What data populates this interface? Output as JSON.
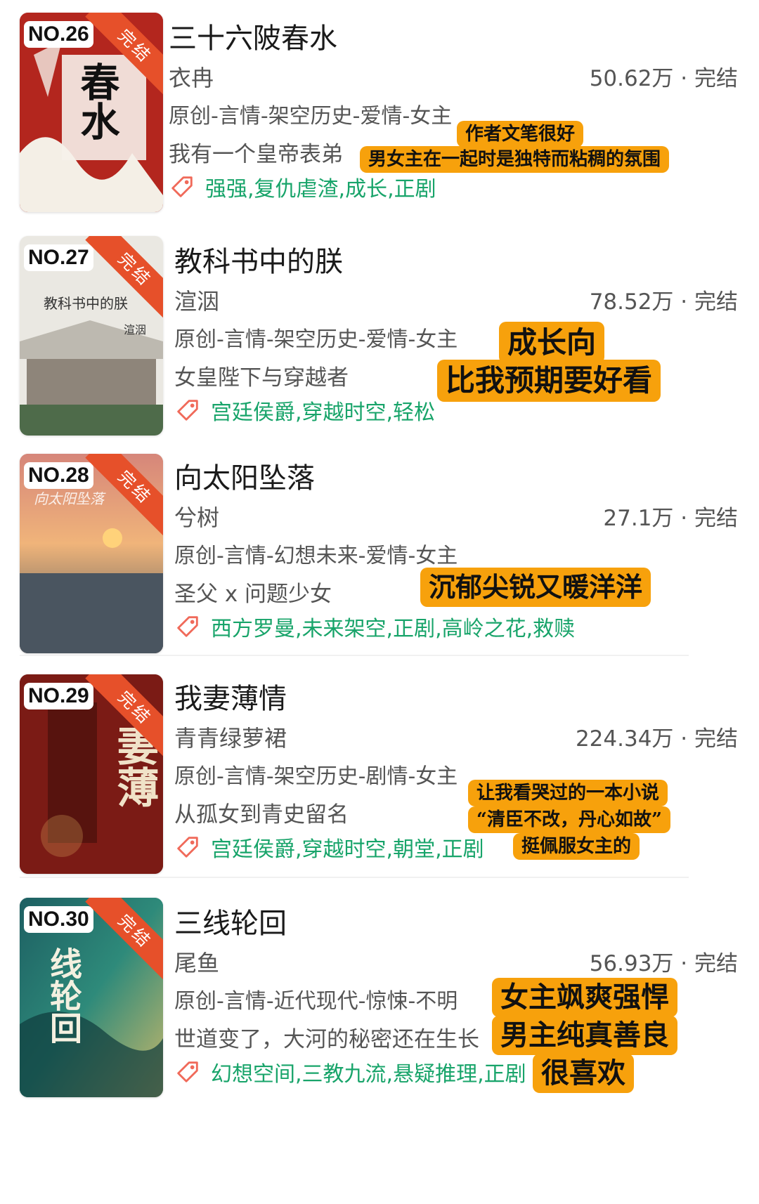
{
  "books": [
    {
      "rank": "NO.26",
      "status_badge": "完结",
      "title": "三十六陂春水",
      "author": "衣冉",
      "stats": "50.62万 · 完结",
      "category": "原创-言情-架空历史-爱情-女主",
      "desc": "我有一个皇帝表弟",
      "tags": "强强,复仇虐渣,成长,正剧",
      "cover_text": "春水",
      "notes": [
        "作者文笔很好",
        "男女主在一起时是独特而粘稠的氛围"
      ]
    },
    {
      "rank": "NO.27",
      "status_badge": "完结",
      "title": "教科书中的朕",
      "author": "渲洇",
      "stats": "78.52万 · 完结",
      "category": "原创-言情-架空历史-爱情-女主",
      "desc": "女皇陛下与穿越者",
      "tags": "宫廷侯爵,穿越时空,轻松",
      "cover_text": "教科书中的朕",
      "cover_author": "渲洇",
      "notes": [
        "成长向",
        "比我预期要好看"
      ]
    },
    {
      "rank": "NO.28",
      "status_badge": "完结",
      "title": "向太阳坠落",
      "author": "兮树",
      "stats": "27.1万 · 完结",
      "category": "原创-言情-幻想未来-爱情-女主",
      "desc": "圣父 x 问题少女",
      "tags": "西方罗曼,未来架空,正剧,高岭之花,救赎",
      "cover_text": "向太阳坠落",
      "notes": [
        "沉郁尖锐又暖洋洋"
      ]
    },
    {
      "rank": "NO.29",
      "status_badge": "完结",
      "title": "我妻薄情",
      "author": "青青绿萝裙",
      "stats": "224.34万 · 完结",
      "category": "原创-言情-架空历史-剧情-女主",
      "desc": "从孤女到青史留名",
      "tags": "宫廷侯爵,穿越时空,朝堂,正剧",
      "cover_text": "妻薄",
      "notes": [
        "让我看哭过的一本小说",
        "“清臣不改，丹心如故”",
        "挺佩服女主的"
      ]
    },
    {
      "rank": "NO.30",
      "status_badge": "完结",
      "title": "三线轮回",
      "author": "尾鱼",
      "stats": "56.93万 · 完结",
      "category": "原创-言情-近代现代-惊悚-不明",
      "desc": "世道变了，大河的秘密还在生长",
      "tags": "幻想空间,三教九流,悬疑推理,正剧",
      "cover_text": "线轮回",
      "notes": [
        "女主飒爽强悍",
        "男主纯真善良",
        "很喜欢"
      ]
    }
  ],
  "colors": {
    "tag_green": "#18a46a",
    "note_orange": "#f7a10c",
    "ribbon_red": "#e6502a"
  },
  "icons": {
    "tag": "tag-icon"
  }
}
